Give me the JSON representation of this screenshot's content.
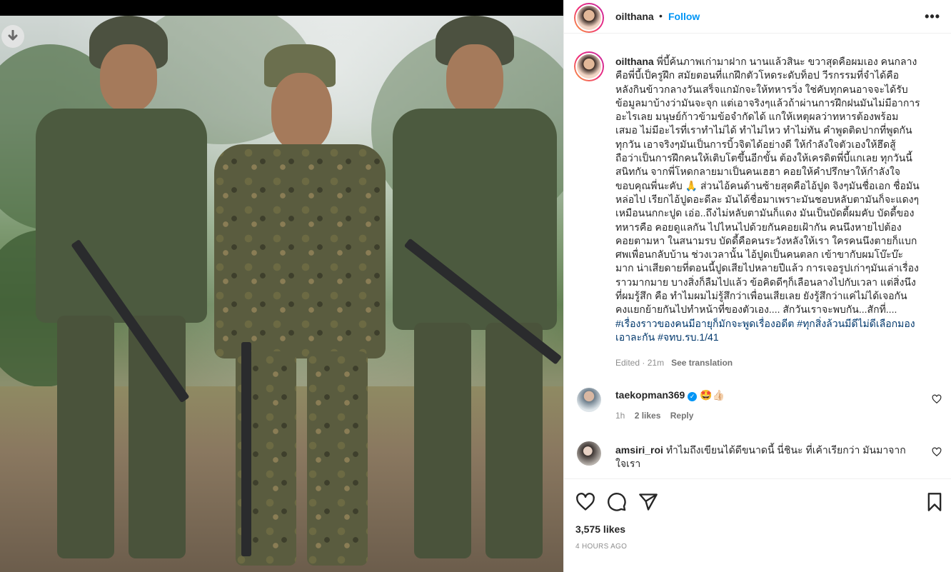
{
  "post": {
    "author": "oilthana",
    "follow_label": "Follow",
    "separator": "•",
    "more_label": "•••"
  },
  "caption": {
    "username": "oilthana",
    "text": "พี่บี้ค้นภาพเก่ามาฝาก นานแล้วสินะ ขวาสุดคือผมเอง คนกลาง\nคือพี่บี้เป็ครูฝึก สมัยตอนที่แกฝึกตัวโหดระดับท็อป วีรกรรมที่จำได้คือ\nหลังกินข้าวกลางวันเสร็จแกมักจะให้ทหารวิ่ง ใช่คับทุกคนอาจจะได้รับ\nข้อมูลมาบ้างว่ามันจะจุก แต่เอาจริงๆแล้วถ้าผ่านการฝึกฝนมันไม่มีอาการ\nอะไรเลย มนุษย์ก้าวข้ามข้อจำกัดได้ แกให้เหตุผลว่าทหารต้องพร้อม\nเสมอ ไม่มีอะไรที่เราทำไม่ได้ ทำไม่ไหว ทำไม่ทัน คำพูดติดปากที่พูดกัน\nทุกวัน เอาจริงๆมันเป็นการบิ้วจิตได้อย่างดี ให้กำลังใจตัวเองให้ฮึดสู้\nถือว่าเป็นการฝึกคนให้เติบโตขึ้นอีกขั้น ต้องให้เครดิตพี่บี้แกเลย ทุกวันนี้\nสนิทกัน จากพี่โหดกลายมาเป็นคนเฮฮา คอยให้คำปรึกษาให้กำลังใจ\nขอบคุณพี่นะคับ 🙏 ส่วนไอ้คนด้านซ้ายสุดคือไอ้ปูด จิงๆมันชื่อเอก ชื่อมัน\nหล่อไป เรียกไอ้ปูดอะดีละ มันได้ชื่อมาเพราะมันชอบหลับตามันก็จะแดงๆ\nเหมือนนกกะปูด เอ่อ..ถึงไม่หลับตามันก็แดง มันเป็นบัดดี้ผมคับ บัดดี้ของ\nทหารคือ คอยดูแลกัน ไปไหนไปด้วยกันคอยเฝ้ากัน คนนึงหายไปต้อง\nคอยตามหา ในสนามรบ บัดดี้คือคนระวังหลังให้เรา ใครคนนึงตายก็แบก\nศพเพื่อนกลับบ้าน ช่วงเวลานั้น ไอ้ปูดเป็นคนตลก เข้าขากับผมโบ๊ะบ๊ะ\nมาก น่าเสียดายที่ตอนนี้ปูดเสียไปหลายปีแล้ว การเจอรูปเก่าๆมันเล่าเรื่อง\nราวมากมาย บางสิ่งก็ลืมไปแล้ว ข้อคิดดีๆก็เลือนลางไปกับเวลา แต่สิ่งนึง\nที่ผมรู้สึก คือ ทำไมผมไม่รู้สึกว่าเพื่อนเสียเลย ยังรู้สึกว่าแค่ไม่ได้เจอกัน\nคงแยกย้ายกันไปทำหน้าที่ของตัวเอง.... สักวันเราจะพบกัน...สักที่....",
    "hashtags": "#เรื่องราวของคนมีอายุก็มักจะพูดเรื่องอดีต #ทุกสิ่งล้วนมีดีไม่ดีเลือกมอง\nเอาละกัน #จทบ.รบ.1/41",
    "edited_label": "Edited",
    "edited_separator": "·",
    "edited_time": "21m",
    "see_translation": "See translation"
  },
  "comments": [
    {
      "username": "taekopman369",
      "text": "🤩👍🏻",
      "time": "1h",
      "likes": "2 likes",
      "reply": "Reply"
    },
    {
      "username": "amsiri_roi",
      "text": "ทำไมถึงเขียนได้ดีขนาดนี้ นี่ชินะ ที่เค้าเรียกว่า มันมาจาก\nใจเรา"
    }
  ],
  "footer": {
    "likes": "3,575 likes",
    "posted_ago": "4 HOURS AGO"
  },
  "colors": {
    "accent": "#0095f6",
    "hashtag": "#00376b",
    "muted": "#8e8e8e",
    "border": "#efefef"
  },
  "icons": [
    "download-icon",
    "more-icon",
    "verified-icon",
    "heart-icon",
    "comment-icon",
    "share-icon",
    "bookmark-icon"
  ]
}
